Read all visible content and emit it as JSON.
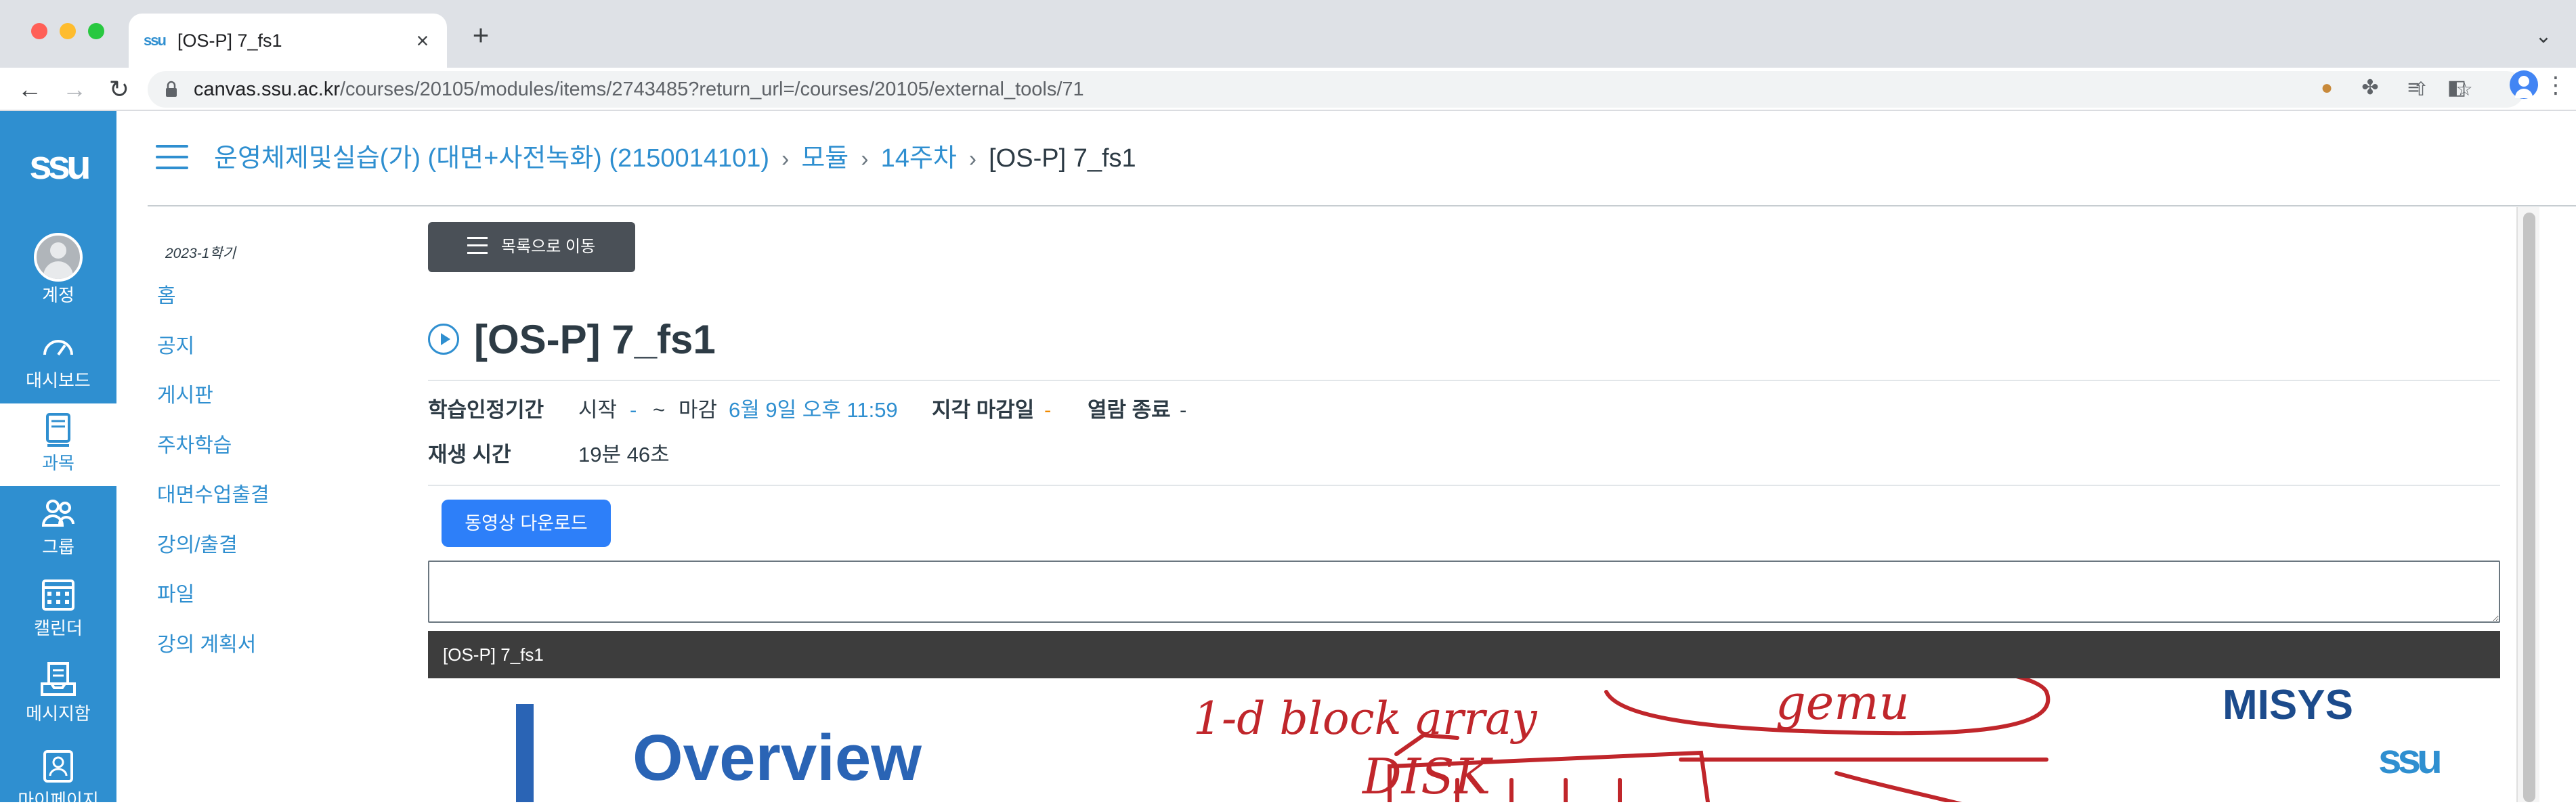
{
  "browser": {
    "tab_title": "[OS-P] 7_fs1",
    "tab_favicon_text": "ssu",
    "url_host": "canvas.ssu.ac.kr",
    "url_path": "/courses/20105/modules/items/2743485?return_url=/courses/20105/external_tools/71",
    "icons": [
      "back-arrow-icon",
      "forward-arrow-icon",
      "reload-icon",
      "lock-icon",
      "share-icon",
      "bookmark-star-icon",
      "cookie-extension-icon",
      "puzzle-extension-icon",
      "media-queue-icon",
      "side-panel-icon",
      "profile-avatar-icon",
      "more-menu-icon"
    ]
  },
  "global_nav": {
    "logo": "ssu",
    "items": [
      {
        "label": "계정",
        "icon": "account-avatar-icon"
      },
      {
        "label": "대시보드",
        "icon": "dashboard-icon"
      },
      {
        "label": "과목",
        "icon": "courses-book-icon",
        "active": true
      },
      {
        "label": "그룹",
        "icon": "groups-icon"
      },
      {
        "label": "캘린더",
        "icon": "calendar-icon"
      },
      {
        "label": "메시지함",
        "icon": "inbox-icon"
      },
      {
        "label": "마이페이지",
        "icon": "mypage-icon"
      }
    ]
  },
  "breadcrumb": {
    "course": "운영체제및실습(가) (대면+사전녹화) (2150014101)",
    "modules": "모듈",
    "week": "14주차",
    "current": "[OS-P] 7_fs1"
  },
  "course_nav": {
    "term": "2023-1학기",
    "items": [
      "홈",
      "공지",
      "게시판",
      "주차학습",
      "대면수업출결",
      "강의/출결",
      "파일",
      "강의 계획서"
    ]
  },
  "content": {
    "list_button": "목록으로 이동",
    "title": "[OS-P] 7_fs1",
    "period_label": "학습인정기간",
    "start_label": "시작",
    "start_value": "-",
    "tilde": "~",
    "due_label": "마감",
    "due_value": "6월 9일 오후 11:59",
    "late_label": "지각 마감일",
    "late_value": "-",
    "close_label": "열람 종료",
    "close_value": "-",
    "playtime_label": "재생 시간",
    "playtime_value": "19분 46초",
    "download_button": "동영상 다운로드",
    "memo_value": ""
  },
  "player": {
    "title": "[OS-P] 7_fs1",
    "slide_heading": "Overview",
    "slide_logo": "MISYS",
    "slide_logo_sub": "ssu",
    "annotations": [
      "1-d block array",
      "gemu",
      "DISK"
    ]
  },
  "colors": {
    "canvas_blue": "#2f8fd0",
    "download_blue": "#2d7ff9",
    "late_orange": "#f08a00",
    "annotation_red": "#c0262b",
    "dark_button": "#4a5057"
  }
}
